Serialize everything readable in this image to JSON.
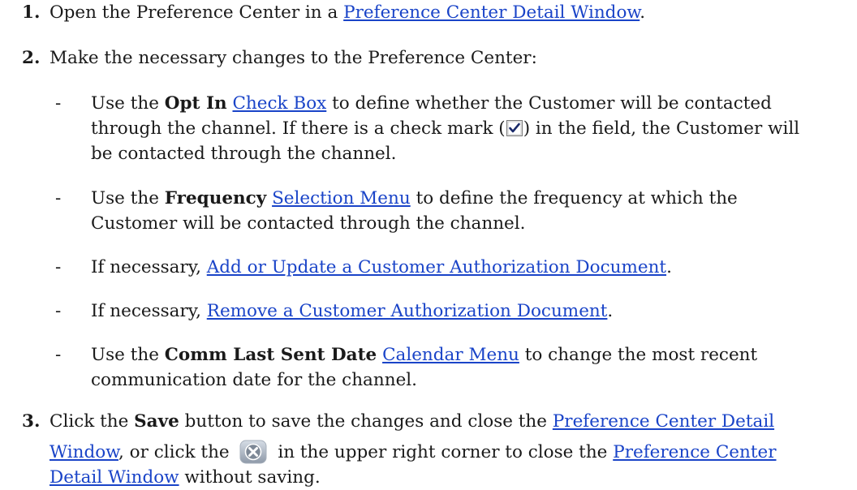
{
  "steps": {
    "s1": {
      "num": "1.",
      "prefix": "Open the Preference Center in a ",
      "link": "Preference Center Detail Window",
      "suffix": "."
    },
    "s2": {
      "num": "2.",
      "text": "Make the necessary changes to the Preference Center:"
    },
    "s3": {
      "num": "3.",
      "t1": "Click the ",
      "save": "Save",
      "t2": " button to save the changes and close the ",
      "link1a": "Preference Center Detail ",
      "link1b": "Window",
      "t3": ", or click the ",
      "t4": " in the upper right corner to close the ",
      "link2a": "Preference Center ",
      "link2b": "Detail Window",
      "t5": " without saving."
    }
  },
  "bullets": {
    "b1": {
      "dash": "-",
      "t1": "Use the ",
      "bold": "Opt In",
      "link": "Check Box",
      "t2": " to define whether the Customer will be contacted",
      "t3": "through the channel. If there is a check mark (",
      "t4": ") in the field, the Customer will",
      "t5": "be contacted through the channel."
    },
    "b2": {
      "dash": "-",
      "t1": "Use the ",
      "bold": "Frequency",
      "link": "Selection Menu",
      "t2": " to define the frequency at which the",
      "t3": "Customer will be contacted through the channel."
    },
    "b3": {
      "dash": "-",
      "t1": "If necessary, ",
      "link": "Add or Update a Customer Authorization Document",
      "t2": "."
    },
    "b4": {
      "dash": "-",
      "t1": "If necessary, ",
      "link": "Remove a Customer Authorization Document",
      "t2": "."
    },
    "b5": {
      "dash": "-",
      "t1": "Use the ",
      "bold": "Comm Last Sent Date",
      "link": "Calendar Menu",
      "t2": " to change the most recent",
      "t3": "communication date for the channel."
    }
  },
  "icons": {
    "checkbox": "checked-checkbox-icon",
    "close": "close-x-icon"
  }
}
